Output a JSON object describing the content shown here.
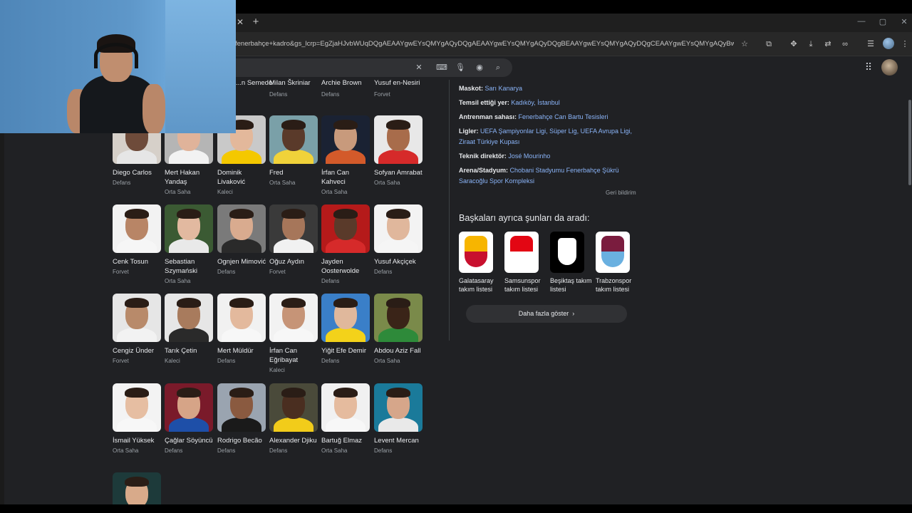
{
  "browser": {
    "url": "fenerbahçe+kadro&gs_lcrp=EgZjaHJvbWUqDQgAEAAYgwEYsQMYgAQyDQgAEAAYgwEYsQMYgAQyDQgBEAAYgwEYsQMYgAQyDQgCEAAYgwEYsQMYgAQyBwgDEC4YgA..."
  },
  "top_row": [
    {
      "name": "...n Semedo",
      "position": ""
    },
    {
      "name": "Milan Škriniar",
      "position": "Defans"
    },
    {
      "name": "Archie Brown",
      "position": "Defans"
    },
    {
      "name": "Yusuf en-Nesiri",
      "position": "Forvet"
    }
  ],
  "players": [
    {
      "name": "Diego Carlos",
      "position": "Defans",
      "colors": [
        "#d6d0c9",
        "#6e4b3a",
        "#e6e6e6"
      ]
    },
    {
      "name": "Mert Hakan Yandaş",
      "position": "Orta Saha",
      "colors": [
        "#b5b5b5",
        "#e0b39a",
        "#f2f2f2"
      ]
    },
    {
      "name": "Dominik Livaković",
      "position": "Kaleci",
      "colors": [
        "#c9c9c9",
        "#e3b89b",
        "#f4c800"
      ]
    },
    {
      "name": "Fred",
      "position": "Orta Saha",
      "colors": [
        "#7aa0a8",
        "#5a3a2a",
        "#f0d23a"
      ]
    },
    {
      "name": "İrfan Can Kahveci",
      "position": "Orta Saha",
      "colors": [
        "#1a2233",
        "#c89a7c",
        "#d35a2a"
      ]
    },
    {
      "name": "Sofyan Amrabat",
      "position": "Orta Saha",
      "colors": [
        "#e8e8e8",
        "#a86c4b",
        "#d62a2a"
      ]
    },
    {
      "name": "Cenk Tosun",
      "position": "Forvet",
      "colors": [
        "#f2f2f2",
        "#b88566",
        "#f6f6f6"
      ]
    },
    {
      "name": "Sebastian Szymański",
      "position": "Orta Saha",
      "colors": [
        "#3b5a33",
        "#e2b9a0",
        "#e9e9e9"
      ]
    },
    {
      "name": "Ognjen Mimović",
      "position": "Defans",
      "colors": [
        "#7a7a7a",
        "#d9ab8f",
        "#2a2a2a"
      ]
    },
    {
      "name": "Oğuz Aydın",
      "position": "Forvet",
      "colors": [
        "#3a3a3a",
        "#a6765a",
        "#f1f1f1"
      ]
    },
    {
      "name": "Jayden Oosterwolde",
      "position": "Defans",
      "colors": [
        "#b51a1a",
        "#5a3a2a",
        "#d62a2a"
      ]
    },
    {
      "name": "Yusuf Akçiçek",
      "position": "Defans",
      "colors": [
        "#f3f3f3",
        "#e0b79c",
        "#f5f5f5"
      ]
    },
    {
      "name": "Cengiz Ünder",
      "position": "Forvet",
      "colors": [
        "#e6e6e6",
        "#b88a6a",
        "#f2f2f2"
      ]
    },
    {
      "name": "Tarık Çetin",
      "position": "Kaleci",
      "colors": [
        "#e6e6e6",
        "#a87b5d",
        "#2a2a2a"
      ]
    },
    {
      "name": "Mert Müldür",
      "position": "Defans",
      "colors": [
        "#f1f1f1",
        "#e3b99d",
        "#f7f7f7"
      ]
    },
    {
      "name": "İrfan Can Eğribayat",
      "position": "Kaleci",
      "colors": [
        "#f2f2f2",
        "#c69477",
        "#f7f7f7"
      ]
    },
    {
      "name": "Yiğit Efe Demir",
      "position": "Defans",
      "colors": [
        "#3a7fc8",
        "#e0b89c",
        "#f3d21a"
      ]
    },
    {
      "name": "Abdou Aziz Fall",
      "position": "Orta Saha",
      "colors": [
        "#7a8a4a",
        "#3a2418",
        "#2e8a3a"
      ]
    },
    {
      "name": "İsmail Yüksek",
      "position": "Orta Saha",
      "colors": [
        "#f3f3f3",
        "#e6bea2",
        "#f7f7f7"
      ]
    },
    {
      "name": "Çağlar Söyüncü",
      "position": "Defans",
      "colors": [
        "#7a1a2a",
        "#d6a487",
        "#1e4fa8"
      ]
    },
    {
      "name": "Rodrigo Becão",
      "position": "Defans",
      "colors": [
        "#9aa4b0",
        "#8a5a40",
        "#1a1a1a"
      ]
    },
    {
      "name": "Alexander Djiku",
      "position": "Defans",
      "colors": [
        "#4a4a3a",
        "#4a2e20",
        "#f2cc1a"
      ]
    },
    {
      "name": "Bartuğ Elmaz",
      "position": "Orta Saha",
      "colors": [
        "#f1f1f1",
        "#e5bb9e",
        "#f7f7f7"
      ]
    },
    {
      "name": "Levent Mercan",
      "position": "Defans",
      "colors": [
        "#1a7a9a",
        "#d6a68a",
        "#e9e9e9"
      ]
    },
    {
      "name": "",
      "position": "",
      "colors": [
        "#1d3a3a",
        "#d8aa8a",
        "#2a6a5a"
      ]
    }
  ],
  "knowledge_panel": {
    "rows": [
      {
        "label": "Maskot:",
        "value": "Sarı Kanarya"
      },
      {
        "label": "Temsil ettiği yer:",
        "value": "Kadıköy, İstanbul"
      },
      {
        "label": "Antrenman sahası:",
        "value": "Fenerbahçe Can Bartu Tesisleri"
      },
      {
        "label": "Ligler:",
        "value": "UEFA Şampiyonlar Ligi, Süper Lig, UEFA Avrupa Ligi, Ziraat Türkiye Kupası"
      },
      {
        "label": "Teknik direktör:",
        "value": "José Mourinho"
      },
      {
        "label": "Arena/Stadyum:",
        "value": "Chobani Stadyumu Fenerbahçe Şükrü Saracoğlu Spor Kompleksi"
      }
    ],
    "feedback": "Geri bildirim",
    "also_heading": "Başkaları ayrıca şunları da aradı:",
    "teams": [
      {
        "name": "Galatasaray takım listesi",
        "primary": "#f7b500",
        "secondary": "#c8102e"
      },
      {
        "name": "Samsunspor takım listesi",
        "primary": "#e30613",
        "secondary": "#ffffff"
      },
      {
        "name": "Beşiktaş takım listesi",
        "primary": "#000000",
        "secondary": "#ffffff"
      },
      {
        "name": "Trabzonspor takım listesi",
        "primary": "#7a1c3e",
        "secondary": "#6ab0e0"
      }
    ],
    "more_button": "Daha fazla göster"
  }
}
